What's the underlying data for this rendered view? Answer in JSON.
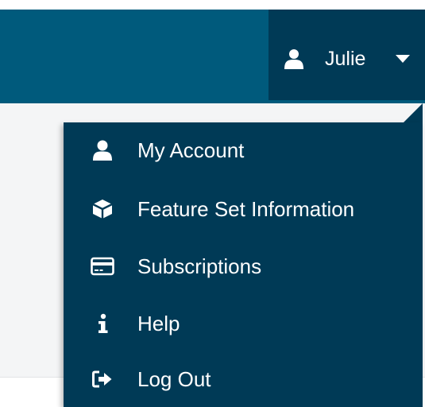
{
  "header": {
    "user_name": "Julie",
    "user_icon": "user-icon",
    "caret_icon": "caret-down-icon"
  },
  "menu": {
    "items": [
      {
        "label": "My Account",
        "icon": "user-icon"
      },
      {
        "label": "Feature Set Information",
        "icon": "cube-icon"
      },
      {
        "label": "Subscriptions",
        "icon": "credit-card-icon"
      },
      {
        "label": "Help",
        "icon": "info-icon"
      },
      {
        "label": "Log Out",
        "icon": "sign-out-icon"
      }
    ]
  },
  "colors": {
    "nav_bar": "#005a7c",
    "user_toggle_bg": "#003a56",
    "dropdown_bg": "#003a56",
    "menu_text": "#ffffff",
    "page_bg": "#f4f5f6"
  }
}
